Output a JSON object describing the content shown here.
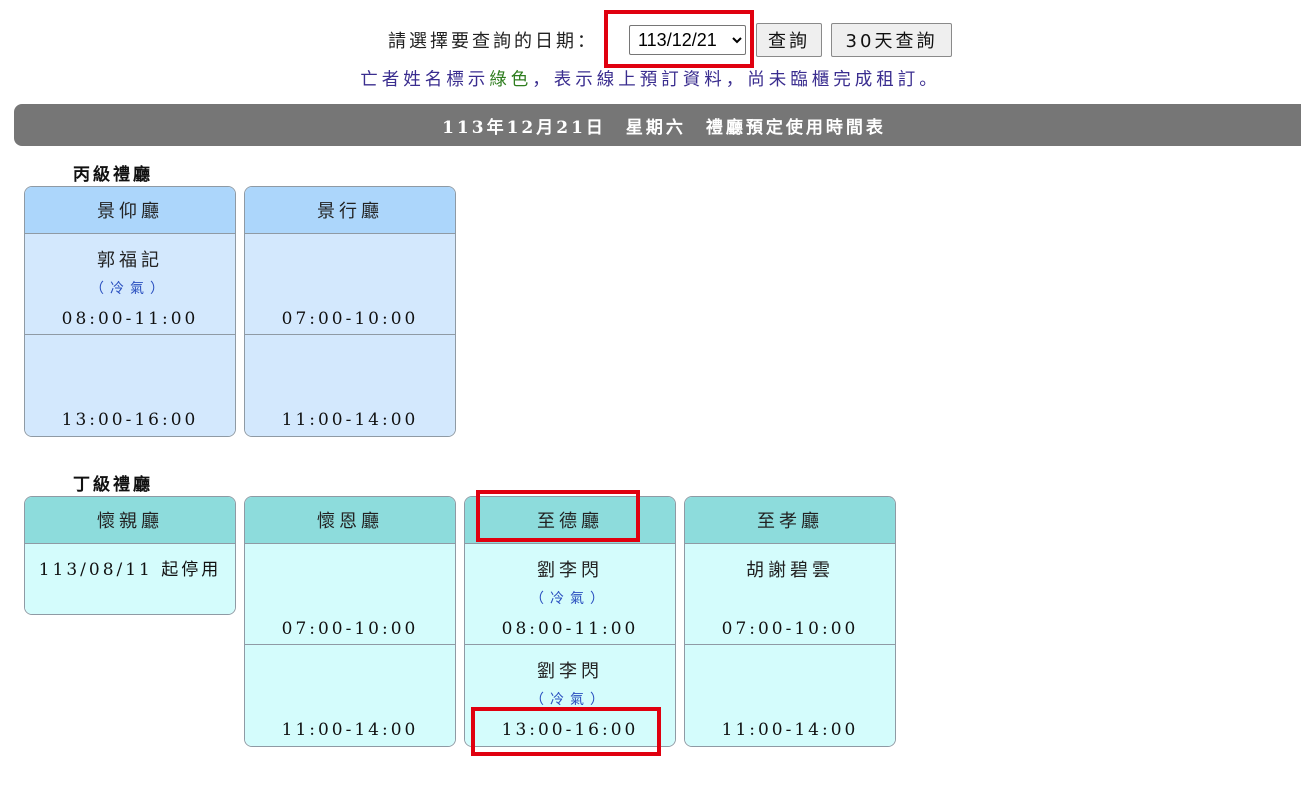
{
  "query": {
    "label": "請選擇要查詢的日期：",
    "selected_date": "113/12/21",
    "query_button": "查詢",
    "query_30_button": "30天查詢"
  },
  "note": {
    "before": "亡者姓名標示",
    "green_word": "綠色",
    "after": "，表示線上預訂資料，尚未臨櫃完成租訂。",
    "green_color": "#2e7d1e",
    "text_color": "#3a2d8f"
  },
  "title_bar": "113年12月21日　星期六　禮廳預定使用時間表",
  "sections": {
    "grade_c": {
      "heading": "丙級禮廳",
      "header_color": "#acd6fb",
      "slot_color": "#d3e8fd",
      "halls": [
        {
          "name": "景仰廳",
          "slots": [
            {
              "deceased": "郭福記",
              "ac": "（冷氣）",
              "time": "08:00-11:00"
            },
            {
              "deceased": "",
              "ac": "",
              "time": "13:00-16:00"
            }
          ]
        },
        {
          "name": "景行廳",
          "slots": [
            {
              "deceased": "",
              "ac": "",
              "time": "07:00-10:00"
            },
            {
              "deceased": "",
              "ac": "",
              "time": "11:00-14:00"
            }
          ]
        }
      ]
    },
    "grade_d": {
      "heading": "丁級禮廳",
      "header_color": "#8ddcdc",
      "slot_color": "#d4fcfc",
      "halls": [
        {
          "name": "懷親廳",
          "closed_notice": "113/08/11 起停用"
        },
        {
          "name": "懷恩廳",
          "slots": [
            {
              "deceased": "",
              "ac": "",
              "time": "07:00-10:00"
            },
            {
              "deceased": "",
              "ac": "",
              "time": "11:00-14:00"
            }
          ]
        },
        {
          "name": "至德廳",
          "slots": [
            {
              "deceased": "劉李閃",
              "ac": "（冷氣）",
              "time": "08:00-11:00"
            },
            {
              "deceased": "劉李閃",
              "ac": "（冷氣）",
              "time": "13:00-16:00"
            }
          ]
        },
        {
          "name": "至孝廳",
          "slots": [
            {
              "deceased": "胡謝碧雲",
              "ac": "",
              "time": "07:00-10:00"
            },
            {
              "deceased": "",
              "ac": "",
              "time": "11:00-14:00"
            }
          ]
        }
      ]
    }
  },
  "highlight_color": "#e0000f"
}
